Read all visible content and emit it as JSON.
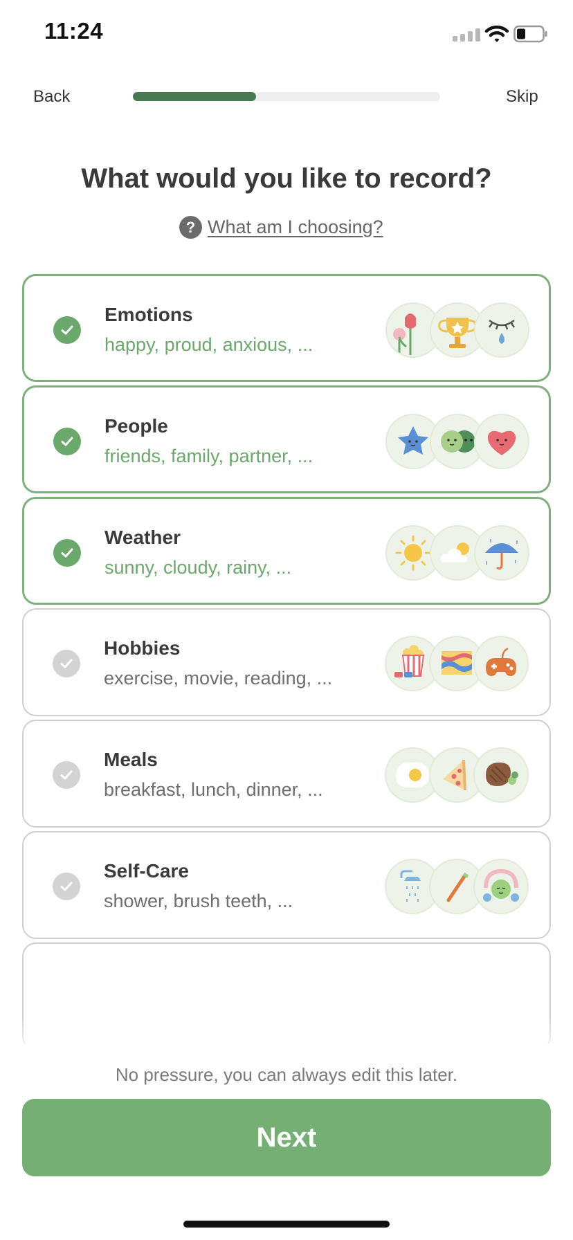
{
  "status_bar": {
    "time": "11:24"
  },
  "nav": {
    "back_label": "Back",
    "skip_label": "Skip",
    "progress": 0.4
  },
  "title": "What would you like to record?",
  "help": {
    "icon_glyph": "?",
    "link_label": "What am I choosing?"
  },
  "categories": [
    {
      "title": "Emotions",
      "subtitle": "happy, proud, anxious, ...",
      "selected": true,
      "icons": [
        "tulips-icon",
        "trophy-icon",
        "crying-eye-icon"
      ]
    },
    {
      "title": "People",
      "subtitle": "friends, family, partner, ...",
      "selected": true,
      "icons": [
        "star-face-icon",
        "two-faces-icon",
        "heart-face-icon"
      ]
    },
    {
      "title": "Weather",
      "subtitle": "sunny, cloudy, rainy, ...",
      "selected": true,
      "icons": [
        "sun-icon",
        "cloud-sun-icon",
        "umbrella-icon"
      ]
    },
    {
      "title": "Hobbies",
      "subtitle": "exercise, movie, reading, ...",
      "selected": false,
      "icons": [
        "popcorn-icon",
        "painting-icon",
        "gamepad-icon"
      ]
    },
    {
      "title": "Meals",
      "subtitle": "breakfast, lunch, dinner, ...",
      "selected": false,
      "icons": [
        "fried-egg-icon",
        "pizza-icon",
        "steak-icon"
      ]
    },
    {
      "title": "Self-Care",
      "subtitle": "shower, brush teeth, ...",
      "selected": false,
      "icons": [
        "shower-icon",
        "toothbrush-icon",
        "face-mask-icon"
      ]
    }
  ],
  "footer_note": "No pressure, you can always edit this later.",
  "next_label": "Next",
  "colors": {
    "accent": "#75af74",
    "selected_border": "#7eb07c",
    "progress": "#487a52"
  }
}
